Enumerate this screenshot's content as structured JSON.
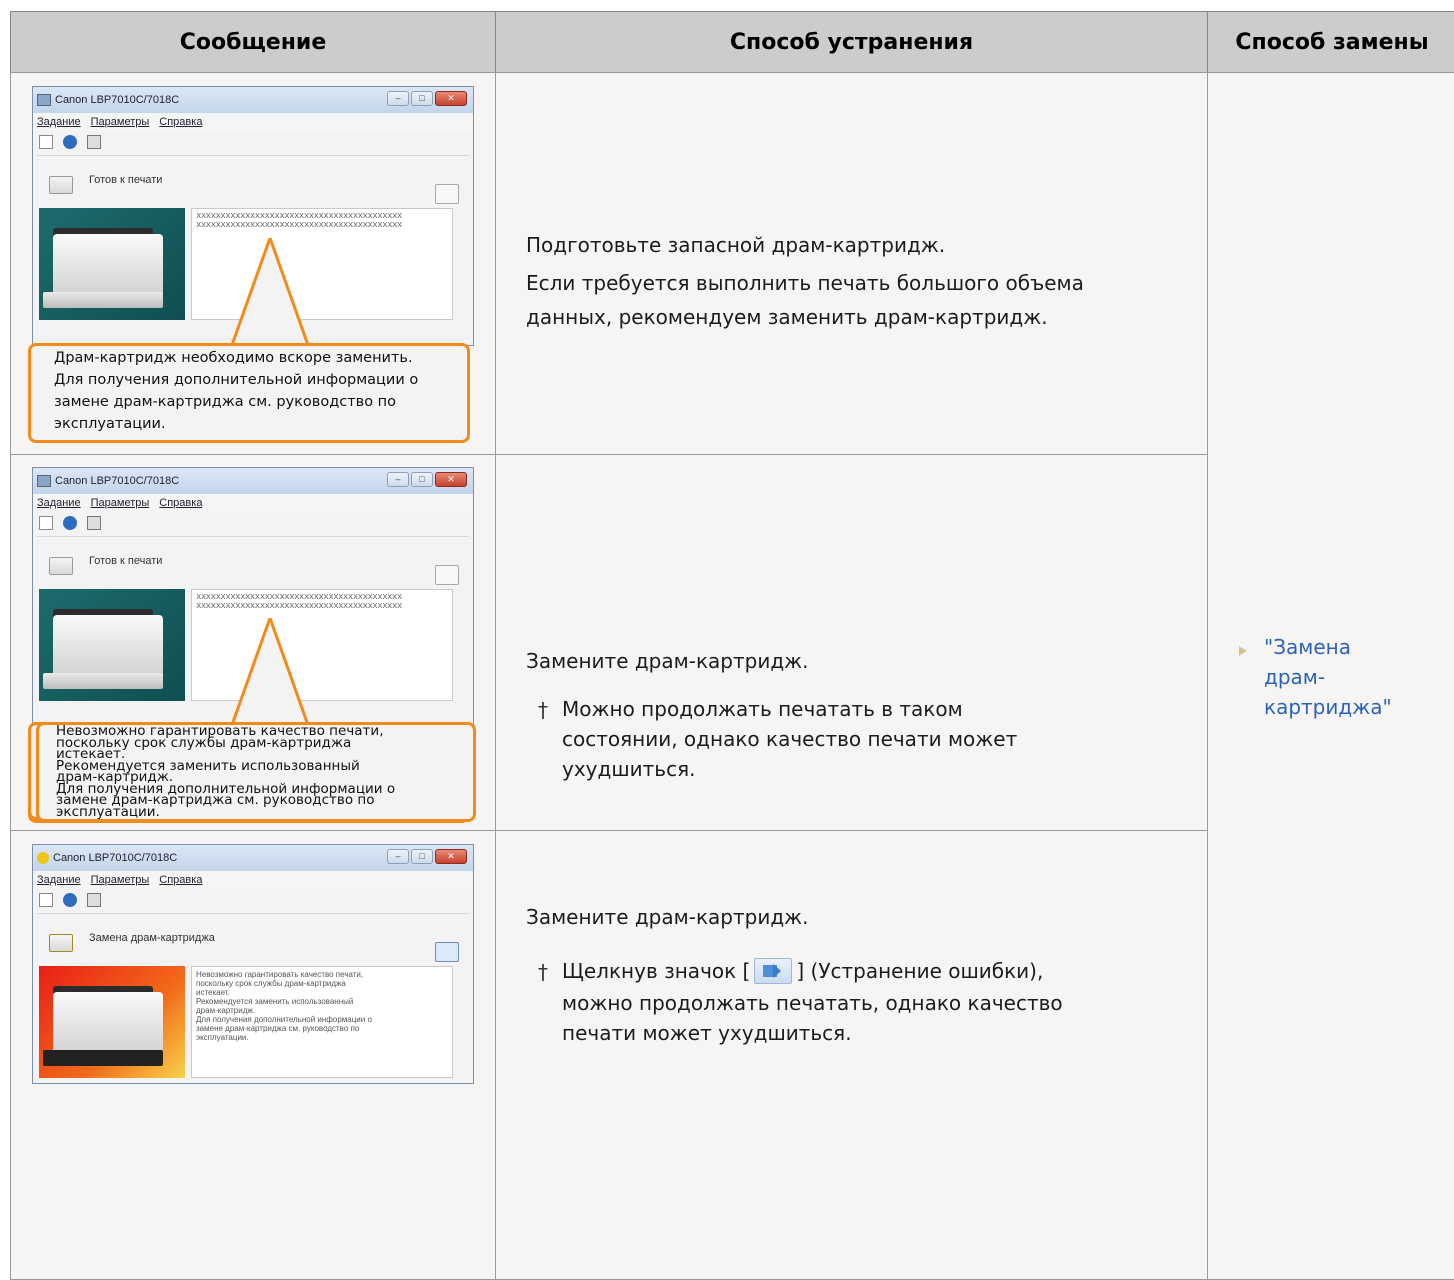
{
  "headers": {
    "message": "Сообщение",
    "solution": "Способ устранения",
    "replace": "Способ замены"
  },
  "window": {
    "title": "Canon LBP7010C/7018C",
    "menu": [
      "Задание",
      "Параметры",
      "Справка"
    ],
    "status_ready": "Готов к печати",
    "status_replace": "Замена драм-картриджа"
  },
  "rows": [
    {
      "callout": [
        "Драм-картридж необходимо вскоре заменить.",
        "Для получения дополнительной информации о",
        "замене драм-картриджа см. руководство по",
        "эксплуатации."
      ],
      "solution_lines": [
        "Подготовьте запасной драм-картридж.",
        "Если требуется выполнить печать большого объема",
        "данных, рекомендуем заменить драм-картридж."
      ]
    },
    {
      "callout": [
        "Невозможно гарантировать качество печати,",
        "поскольку срок службы драм-картриджа",
        "истекает.",
        "Рекомендуется заменить использованный",
        "драм-картридж.",
        "Для получения дополнительной информации о",
        "замене драм-картриджа см. руководство по",
        "эксплуатации."
      ],
      "solution_main": "Замените драм-картридж.",
      "note_lines": [
        "Можно продолжать печатать в таком",
        "состоянии, однако качество печати может",
        "ухудшиться."
      ]
    },
    {
      "msgbox": [
        "Невозможно гарантировать качество печати,",
        "поскольку срок службы драм-картриджа",
        "истекает.",
        "Рекомендуется заменить использованный",
        "драм-картридж.",
        "Для получения дополнительной информации о",
        "замене драм-картриджа см. руководство по",
        "эксплуатации."
      ],
      "solution_main": "Замените драм-картридж.",
      "note_prefix": "Щелкнув значок [",
      "note_suffix": "] (Устранение ошибки),",
      "note_lines": [
        "можно продолжать печатать, однако качество",
        "печати может ухудшиться."
      ]
    }
  ],
  "link": {
    "lines": [
      "\"Замена",
      "драм-",
      "картриджа\""
    ]
  },
  "colors": {
    "header_bg": "#cccccc",
    "cell_bg": "#f6f5f4",
    "callout_border": "#f28a1c",
    "link": "#2a63b8"
  }
}
